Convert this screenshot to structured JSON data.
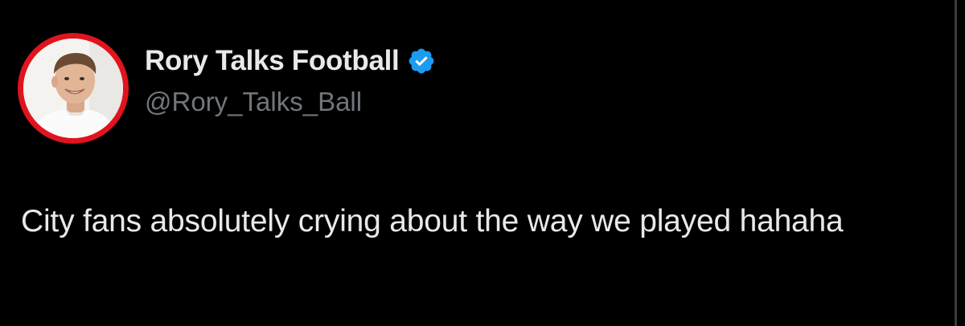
{
  "author": {
    "display_name": "Rory Talks Football",
    "handle": "@Rory_Talks_Ball",
    "verified": true,
    "avatar_icon": "profile-photo",
    "avatar_ring_color": "#e0141e"
  },
  "tweet": {
    "text": "City fans absolutely crying about the way we played hahaha"
  },
  "colors": {
    "background": "#000000",
    "primary_text": "#e7e9ea",
    "secondary_text": "#71767b",
    "verified_badge": "#1d9bf0"
  }
}
